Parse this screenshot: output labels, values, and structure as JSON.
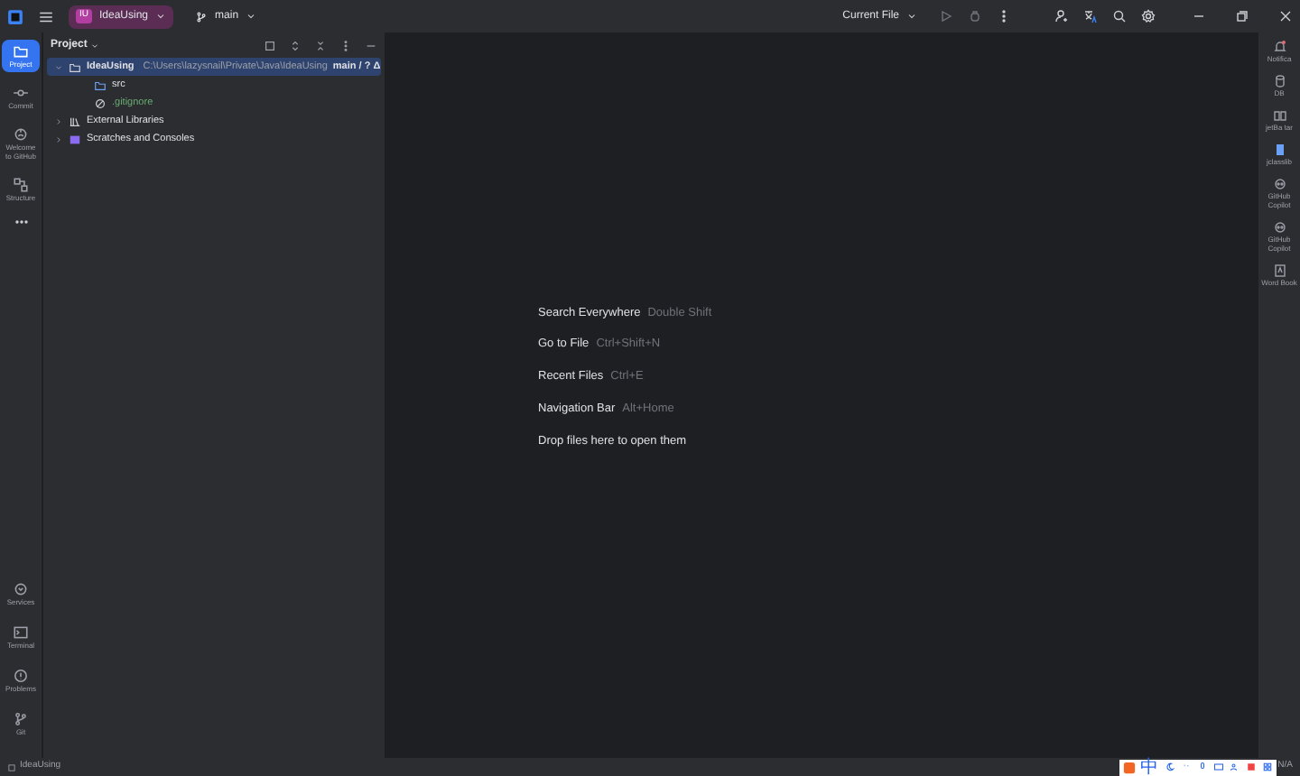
{
  "title_bar": {
    "project_badge": "IU",
    "project": "IdeaUsing",
    "branch": "main",
    "run_config": "Current File"
  },
  "left_toolbar": {
    "top": [
      {
        "label": "Project",
        "selected": true
      },
      {
        "label": "Commit",
        "selected": false
      },
      {
        "label": "Welcome to GitHub",
        "selected": false
      },
      {
        "label": "Structure",
        "selected": false
      }
    ],
    "bottom": [
      {
        "label": "Services"
      },
      {
        "label": "Terminal"
      },
      {
        "label": "Problems"
      },
      {
        "label": "Git"
      }
    ]
  },
  "project_panel": {
    "title": "Project",
    "tree": [
      {
        "label": "IdeaUsing",
        "path": "C:\\Users\\lazysnail\\Private\\Java\\IdeaUsing",
        "vcs": "main / ? Δ",
        "selected": true,
        "expanded": true,
        "kind": "module",
        "children": [
          {
            "label": "src",
            "kind": "folder",
            "selected": false
          },
          {
            "label": ".gitignore",
            "kind": "ignored",
            "selected": false
          }
        ]
      },
      {
        "label": "External Libraries",
        "kind": "libraries",
        "selected": false,
        "expanded": false
      },
      {
        "label": "Scratches and Consoles",
        "kind": "scratches",
        "selected": false,
        "expanded": false
      }
    ]
  },
  "editor_hints": [
    {
      "action": "Search Everywhere",
      "shortcut": "Double Shift"
    },
    {
      "action": "Go to File",
      "shortcut": "Ctrl+Shift+N"
    },
    {
      "action": "Recent Files",
      "shortcut": "Ctrl+E"
    },
    {
      "action": "Navigation Bar",
      "shortcut": "Alt+Home"
    },
    {
      "action": "Drop files here to open them"
    }
  ],
  "right_toolbar": [
    "Notifica",
    "DB",
    "jetBa tar",
    "jclasslib",
    "GitHub Copilot",
    "GitHub Copilot",
    "Word Book"
  ],
  "status_bar": {
    "path": "IdeaUsing",
    "right": "N/A",
    "ime": "中"
  }
}
